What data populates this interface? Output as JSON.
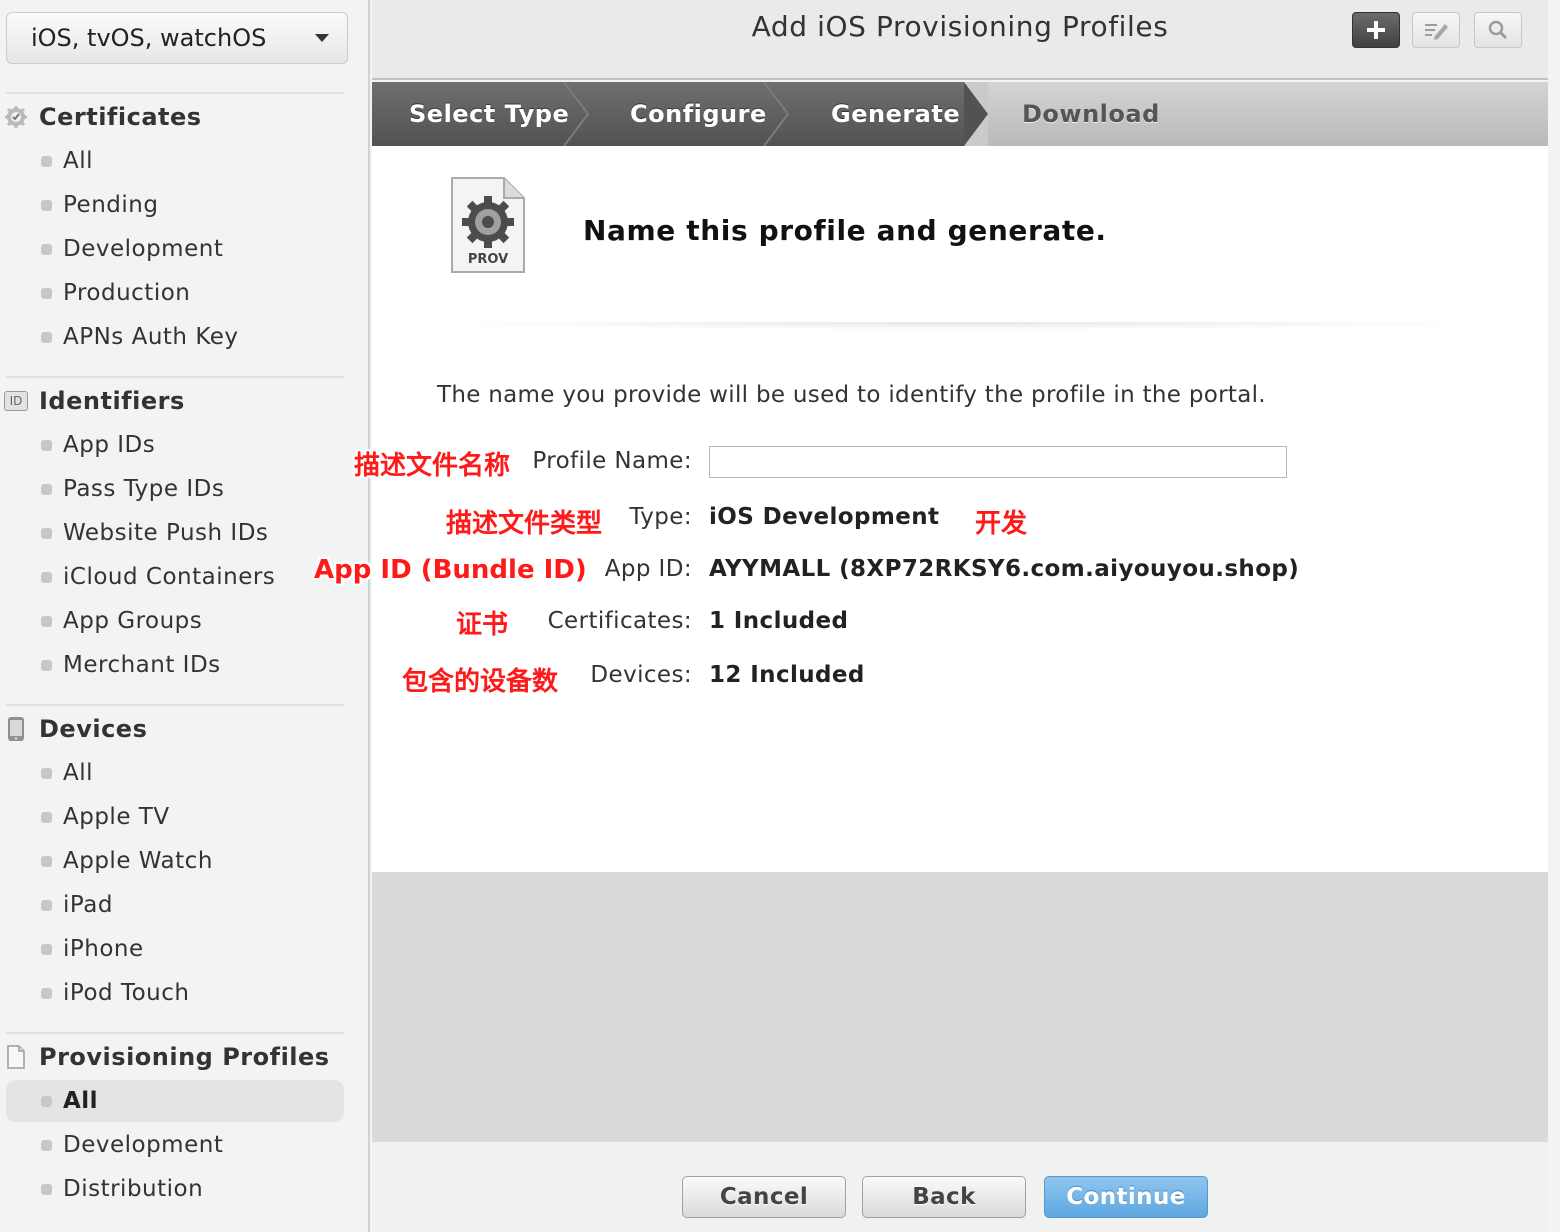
{
  "sidebar": {
    "platform": "iOS, tvOS, watchOS",
    "sections": [
      {
        "title": "Certificates",
        "icon": "certificate-gear-icon",
        "items": [
          "All",
          "Pending",
          "Development",
          "Production",
          "APNs Auth Key"
        ]
      },
      {
        "title": "Identifiers",
        "icon": "id-badge-icon",
        "icon_text": "ID",
        "items": [
          "App IDs",
          "Pass Type IDs",
          "Website Push IDs",
          "iCloud Containers",
          "App Groups",
          "Merchant IDs"
        ]
      },
      {
        "title": "Devices",
        "icon": "device-phone-icon",
        "items": [
          "All",
          "Apple TV",
          "Apple Watch",
          "iPad",
          "iPhone",
          "iPod Touch"
        ]
      },
      {
        "title": "Provisioning Profiles",
        "icon": "document-icon",
        "items": [
          "All",
          "Development",
          "Distribution"
        ],
        "active_item": "All"
      }
    ]
  },
  "header": {
    "title": "Add iOS Provisioning Profiles",
    "toolbar_icons": [
      "plus-icon",
      "edit-icon",
      "search-icon"
    ]
  },
  "steps": [
    {
      "label": "Select Type",
      "state": "done"
    },
    {
      "label": "Configure",
      "state": "done"
    },
    {
      "label": "Generate",
      "state": "done"
    },
    {
      "label": "Download",
      "state": "pending"
    }
  ],
  "content": {
    "icon_text": "PROV",
    "headline": "Name this profile and generate.",
    "intro": "The name you provide will be used to identify the profile in the portal.",
    "fields": {
      "profile_name": {
        "label": "Profile Name:",
        "value": "",
        "placeholder": ""
      },
      "type": {
        "label": "Type:",
        "value": "iOS Development"
      },
      "app_id": {
        "label": "App ID:",
        "value": "AYYMALL (8XP72RKSY6.com.aiyouyou.shop)"
      },
      "certificates": {
        "label": "Certificates:",
        "value": "1 Included"
      },
      "devices": {
        "label": "Devices:",
        "value": "12 Included"
      }
    }
  },
  "annotations": {
    "profile_name": "描述文件名称",
    "type": "描述文件类型",
    "type_value": "开发",
    "app_id": "App ID (Bundle ID)",
    "certificates": "证书",
    "devices": "包含的设备数"
  },
  "footer": {
    "cancel": "Cancel",
    "back": "Back",
    "continue": "Continue"
  },
  "colors": {
    "accent_blue": "#5ea6e0",
    "annotation_red": "#ff1a1a",
    "step_done": "#5f6163"
  }
}
